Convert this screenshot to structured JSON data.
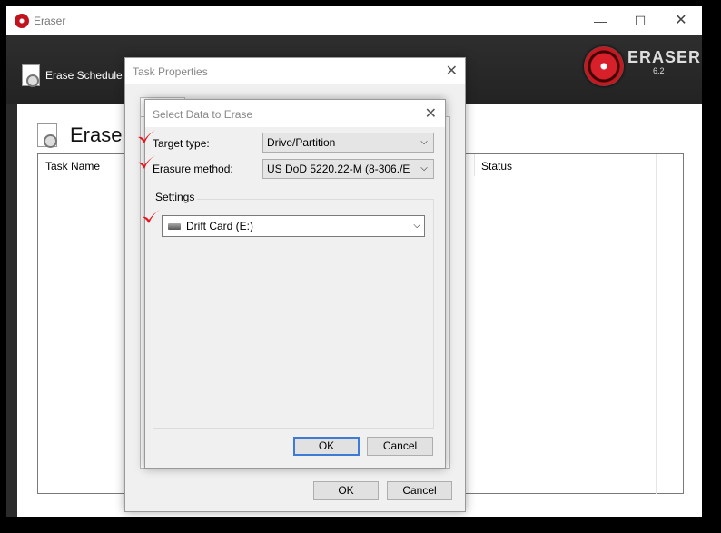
{
  "main_window": {
    "title": "Eraser",
    "minimize_glyph": "—",
    "maximize_glyph": "☐",
    "close_glyph": "✕",
    "toolbar": {
      "erase_schedule_label": "Erase Schedule"
    },
    "logo": {
      "text": "ERASER",
      "version": "6.2"
    },
    "heading": "Erase",
    "task_list": {
      "columns": [
        "Task Name",
        "Status"
      ]
    }
  },
  "task_properties": {
    "title": "Task Properties",
    "close_glyph": "✕",
    "ok_label": "OK",
    "cancel_label": "Cancel"
  },
  "select_data": {
    "title": "Select Data to Erase",
    "close_glyph": "✕",
    "target_type_label": "Target type:",
    "target_type_value": "Drive/Partition",
    "erasure_method_label": "Erasure method:",
    "erasure_method_value": "US DoD 5220.22-M (8-306./E",
    "settings_label": "Settings",
    "drive_value": "Drift Card (E:)",
    "ok_label": "OK",
    "cancel_label": "Cancel"
  },
  "icons": {
    "app": "eraser-app-icon",
    "erase_schedule": "document-clock-icon",
    "drive": "drive-icon",
    "chevron": "chevron-down-icon",
    "annotation": "red-checkmark-icon"
  },
  "colors": {
    "annotation_red": "#e8141c",
    "default_button_border": "#3d7bd6",
    "toolbar_bg": "#2b2b2b"
  }
}
